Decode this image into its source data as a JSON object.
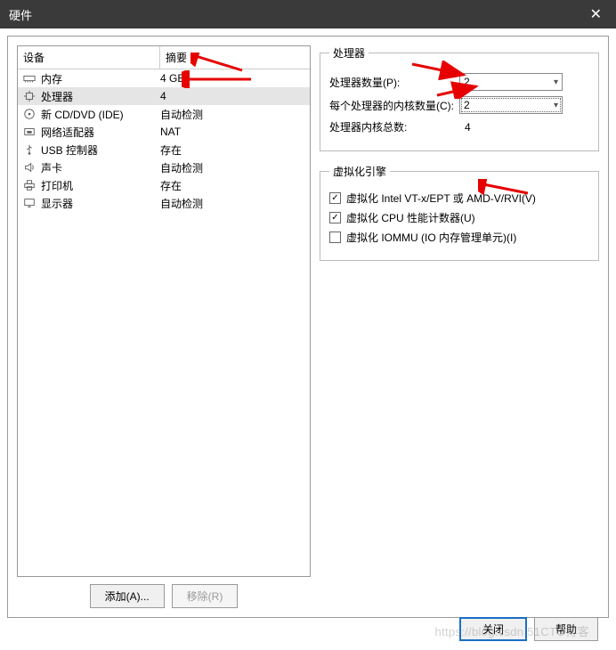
{
  "title": "硬件",
  "columns": {
    "device": "设备",
    "summary": "摘要"
  },
  "devices": [
    {
      "icon": "memory-icon",
      "name": "内存",
      "summary": "4 GB"
    },
    {
      "icon": "cpu-icon",
      "name": "处理器",
      "summary": "4",
      "selected": true
    },
    {
      "icon": "cd-icon",
      "name": "新 CD/DVD (IDE)",
      "summary": "自动检测"
    },
    {
      "icon": "network-icon",
      "name": "网络适配器",
      "summary": "NAT"
    },
    {
      "icon": "usb-icon",
      "name": "USB 控制器",
      "summary": "存在"
    },
    {
      "icon": "sound-icon",
      "name": "声卡",
      "summary": "自动检测"
    },
    {
      "icon": "printer-icon",
      "name": "打印机",
      "summary": "存在"
    },
    {
      "icon": "display-icon",
      "name": "显示器",
      "summary": "自动检测"
    }
  ],
  "leftButtons": {
    "add": "添加(A)...",
    "remove": "移除(R)"
  },
  "processor": {
    "legend": "处理器",
    "countLabel": "处理器数量(P):",
    "countValue": "2",
    "coresLabel": "每个处理器的内核数量(C):",
    "coresValue": "2",
    "totalLabel": "处理器内核总数:",
    "totalValue": "4"
  },
  "virtualization": {
    "legend": "虚拟化引擎",
    "opt1": {
      "checked": true,
      "label": "虚拟化 Intel VT-x/EPT 或 AMD-V/RVI(V)"
    },
    "opt2": {
      "checked": true,
      "label": "虚拟化 CPU 性能计数器(U)"
    },
    "opt3": {
      "checked": false,
      "label": "虚拟化 IOMMU (IO 内存管理单元)(I)"
    }
  },
  "bottom": {
    "close": "关闭",
    "help": "帮助"
  },
  "watermark": "https://blog.csdn.51CTO博客"
}
